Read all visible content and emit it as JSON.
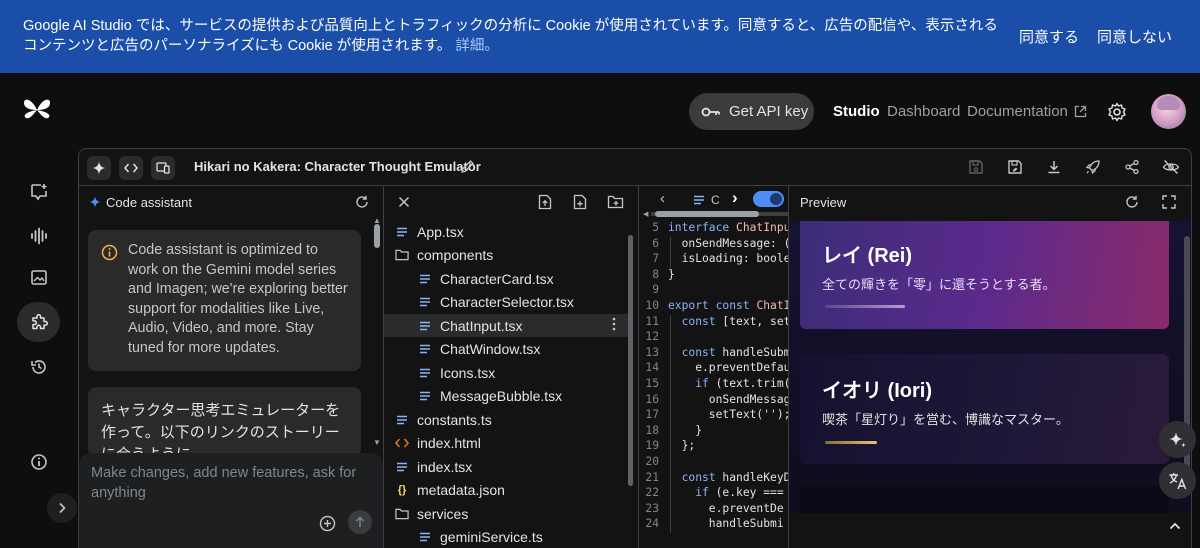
{
  "cookie_banner": {
    "message": "Google AI Studio では、サービスの提供および品質向上とトラフィックの分析に Cookie が使用されています。同意すると、広告の配信や、表示されるコンテンツと広告のパーソナライズにも Cookie が使用されます。",
    "details_link": "詳細。",
    "accept_label": "同意する",
    "decline_label": "同意しない"
  },
  "header": {
    "api_key_label": "Get API key",
    "nav": {
      "studio": "Studio",
      "dashboard": "Dashboard",
      "documentation": "Documentation"
    }
  },
  "app": {
    "title": "Hikari no Kakera: Character Thought Emulator"
  },
  "assistant": {
    "title": "Code assistant",
    "notice": "Code assistant is optimized to work on the Gemini model series and Imagen; we're exploring better support for modalities like Live, Audio, Video, and more. Stay tuned for more updates.",
    "user_message": "キャラクター思考エミュレーターを作って。以下のリンクのストーリーに合うように。",
    "input_placeholder": "Make changes, add new features, ask for anything"
  },
  "file_tree": [
    {
      "name": "App.tsx",
      "kind": "file"
    },
    {
      "name": "components",
      "kind": "folder"
    },
    {
      "name": "CharacterCard.tsx",
      "kind": "file"
    },
    {
      "name": "CharacterSelector.tsx",
      "kind": "file"
    },
    {
      "name": "ChatInput.tsx",
      "kind": "file"
    },
    {
      "name": "ChatWindow.tsx",
      "kind": "file"
    },
    {
      "name": "Icons.tsx",
      "kind": "file"
    },
    {
      "name": "MessageBubble.tsx",
      "kind": "file"
    },
    {
      "name": "constants.ts",
      "kind": "file"
    },
    {
      "name": "index.html",
      "kind": "html"
    },
    {
      "name": "index.tsx",
      "kind": "file"
    },
    {
      "name": "metadata.json",
      "kind": "json"
    },
    {
      "name": "services",
      "kind": "folder"
    },
    {
      "name": "geminiService.ts",
      "kind": "file"
    }
  ],
  "editor": {
    "tab_label": "C",
    "line_numbers": [
      "5",
      "6",
      "7",
      "8",
      "9",
      "10",
      "11",
      "12",
      "13",
      "14",
      "15",
      "16",
      "17",
      "18",
      "19",
      "20",
      "21",
      "22",
      "23",
      "24"
    ],
    "lines": [
      "interface ChatInpu",
      "  onSendMessage: (t",
      "  isLoading: boolea",
      "}",
      "",
      "export const ChatIn",
      "  const [text, setT",
      "",
      "  const handleSubmi",
      "    e.preventDefaul",
      "    if (text.trim()",
      "      onSendMessage",
      "      setText('');",
      "    }",
      "  };",
      "",
      "  const handleKeyDo",
      "    if (e.key === '",
      "      e.preventDe",
      "      handleSubmi"
    ]
  },
  "preview": {
    "title": "Preview",
    "cards": [
      {
        "name": "レイ (Rei)",
        "desc": "全ての輝きを「零」に還そうとする者。"
      },
      {
        "name": "イオリ (Iori)",
        "desc": "喫茶「星灯り」を営む、博識なマスター。"
      }
    ]
  },
  "colors": {
    "banner": "#1a4ea8",
    "rei_gradient": [
      "#3b2d78",
      "#5b2a8c",
      "#8a2a6a"
    ],
    "iori_accent": "#e0b060"
  }
}
